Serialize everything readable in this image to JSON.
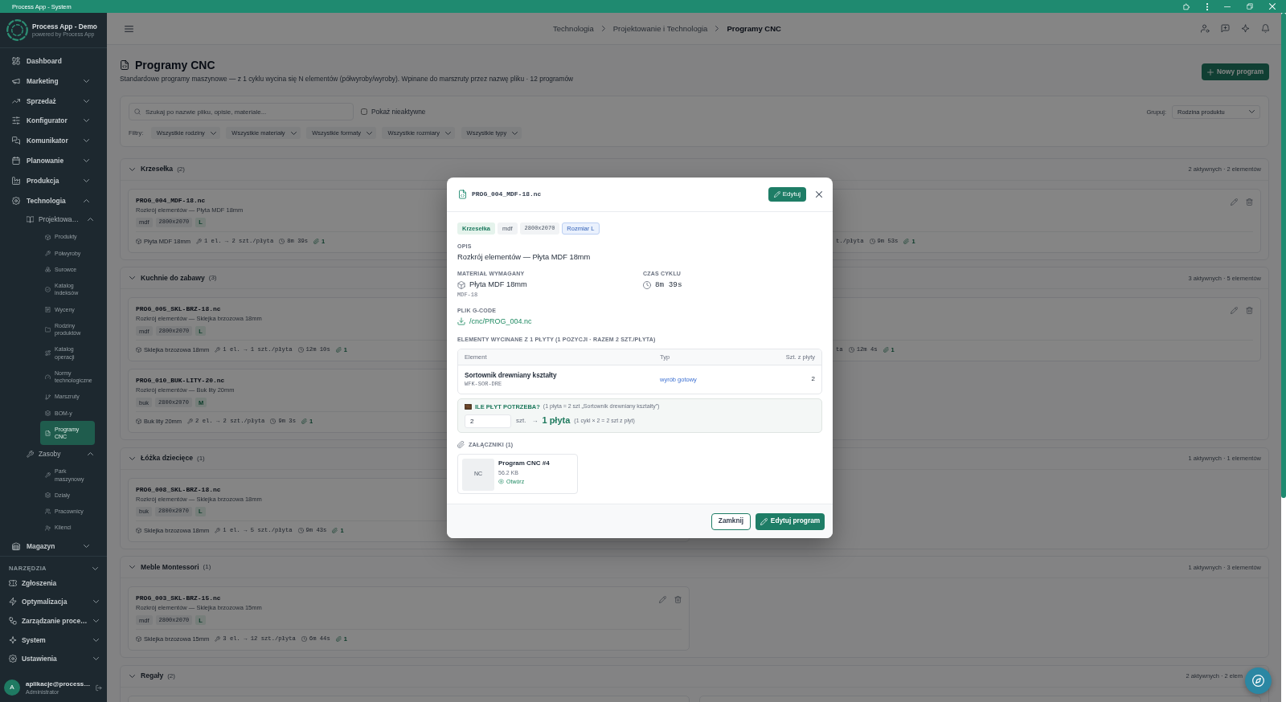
{
  "window": {
    "title": "Process App - System"
  },
  "sidebar": {
    "brand": {
      "name": "Process App - Demo",
      "tagline": "powered by Process App"
    },
    "items": [
      {
        "label": "Dashboard",
        "selected": false
      },
      {
        "label": "Marketing",
        "selected": false,
        "expanded": false
      },
      {
        "label": "Sprzedaż",
        "selected": false,
        "expanded": false
      },
      {
        "label": "Konfigurator",
        "selected": false,
        "expanded": false
      },
      {
        "label": "Komunikator",
        "selected": false,
        "expanded": false
      },
      {
        "label": "Planowanie",
        "selected": false,
        "expanded": false
      },
      {
        "label": "Produkcja",
        "selected": false,
        "expanded": false
      },
      {
        "label": "Technologia",
        "selected": false,
        "expanded": true,
        "children": [
          {
            "label": "Projektowa…",
            "selected": false,
            "expanded": true,
            "children": [
              {
                "label": "Produkty",
                "selected": false
              },
              {
                "label": "Półwyroby",
                "selected": false
              },
              {
                "label": "Surowce",
                "selected": false
              },
              {
                "label": "Katalog indeksów",
                "selected": false
              },
              {
                "label": "Wyceny",
                "selected": false
              },
              {
                "label": "Rodziny produktów",
                "selected": false
              },
              {
                "label": "Katalog operacji",
                "selected": false
              },
              {
                "label": "Normy technologiczne",
                "selected": false
              },
              {
                "label": "Marszruty",
                "selected": false
              },
              {
                "label": "BOM-y",
                "selected": false
              },
              {
                "label": "Programy CNC",
                "selected": true
              }
            ]
          },
          {
            "label": "Zasoby",
            "selected": false,
            "expanded": true,
            "children": [
              {
                "label": "Park maszynowy",
                "selected": false
              },
              {
                "label": "Działy",
                "selected": false
              },
              {
                "label": "Pracownicy",
                "selected": false
              },
              {
                "label": "Klienci",
                "selected": false
              }
            ]
          }
        ]
      },
      {
        "label": "Magazyn",
        "selected": false,
        "expanded": false
      }
    ],
    "tools": {
      "title": "NARZĘDZIA",
      "items": [
        {
          "label": "Zgłoszenia",
          "selected": false
        },
        {
          "label": "Optymalizacja",
          "selected": false,
          "expanded": false
        },
        {
          "label": "Zarządzanie proce…",
          "selected": false,
          "expanded": false
        },
        {
          "label": "System",
          "selected": false,
          "expanded": false
        },
        {
          "label": "Ustawienia",
          "selected": false,
          "expanded": false
        }
      ]
    },
    "user": {
      "initial": "A",
      "name": "aplikacje@process…",
      "role": "Administrator"
    }
  },
  "header": {
    "breadcrumb": [
      {
        "label": "Technologia",
        "selected": false
      },
      {
        "label": "Projektowanie i Technologia",
        "selected": false
      },
      {
        "label": "Programy CNC",
        "selected": true
      }
    ]
  },
  "page": {
    "title": "Programy CNC",
    "subtitle": "Standardowe programy maszynowe — z 1 cyklu wycina się N elementów (półwyroby/wyroby). Wpinane do marszruty przez nazwę pliku · 12 programów",
    "new_button": "Nowy program"
  },
  "filters": {
    "search": {
      "placeholder": "Szukaj po nazwie pliku, opisie, materiale..."
    },
    "show_inactive": {
      "label": "Pokaż nieaktywne",
      "checked": false
    },
    "group_by": {
      "label": "Grupuj:",
      "value": "Rodzina produktu"
    },
    "label": "Filtry:",
    "selects": [
      "Wszystkie rodziny",
      "Wszystkie materiały",
      "Wszystkie formaty",
      "Wszystkie rozmiary",
      "Wszystkie typy"
    ]
  },
  "groups": [
    {
      "name": "Krzesełka",
      "count": "(2)",
      "summary": "2 aktywnych · 2 elementów",
      "expanded": true,
      "programs": [
        {
          "kind": "clipped_right",
          "file": "PROG_004_MDF-18.nc",
          "description": "Rozkrój elementów — Płyta MDF 18mm",
          "tags": [
            {
              "kind": "material",
              "text": "mdf"
            },
            {
              "kind": "format",
              "text": "2800x2070"
            },
            {
              "kind": "size",
              "text": "L"
            }
          ],
          "material": "Płyta MDF 18mm",
          "output": "1 el. → 2 szt./płyta",
          "cycle_time": "8m 39s",
          "attachments": "1"
        },
        {
          "kind": "clipped_left",
          "output_tail": "t./płyta",
          "cycle_time": "9m 53s",
          "attachments": "1"
        }
      ]
    },
    {
      "name": "Kuchnie do zabawy",
      "count": "(3)",
      "summary": "3 aktywnych · 5 elementów",
      "expanded": true,
      "programs": [
        {
          "kind": "clipped_right",
          "file": "PROG_005_SKL-BRZ-18.nc",
          "description": "Rozkrój elementów — Sklejka brzozowa 18mm",
          "tags": [
            {
              "kind": "material",
              "text": "mdf"
            },
            {
              "kind": "format",
              "text": "2800x2070"
            },
            {
              "kind": "size",
              "text": "L"
            }
          ],
          "material": "Sklejka brzozowa 18mm",
          "output": "1 el. → 1 szt./płyta",
          "cycle_time": "12m 10s",
          "attachments": "1"
        },
        {
          "kind": "clipped_left",
          "output_tail": "ta",
          "cycle_time": "12m 4s",
          "attachments": "1"
        },
        {
          "kind": "clipped_right",
          "file": "PROG_010_BUK-LITY-20.nc",
          "description": "Rozkrój elementów — Buk lity 20mm",
          "tags": [
            {
              "kind": "material",
              "text": "buk"
            },
            {
              "kind": "format",
              "text": "2800x2070"
            },
            {
              "kind": "size",
              "text": "M"
            }
          ],
          "material": "Buk lity 20mm",
          "output": "2 el. → 2 szt./płyta",
          "cycle_time": "9m 3s",
          "attachments": "1"
        }
      ]
    },
    {
      "name": "Łóżka dziecięce",
      "count": "(1)",
      "summary": "1 aktywnych · 1 elementów",
      "expanded": true,
      "programs": [
        {
          "kind": "clipped_right",
          "file": "PROG_008_SKL-BRZ-18.nc",
          "description": "Rozkrój elementów — Sklejka brzozowa 18mm",
          "tags": [
            {
              "kind": "material",
              "text": "buk"
            },
            {
              "kind": "format",
              "text": "2800x2070"
            },
            {
              "kind": "size",
              "text": "L"
            }
          ],
          "material": "Sklejka brzozowa 18mm",
          "output": "1 el. → 5 szt./płyta",
          "cycle_time": "9m 43s",
          "attachments": "1"
        }
      ]
    },
    {
      "name": "Meble Montessori",
      "count": "(1)",
      "summary": "1 aktywnych · 3 elementów",
      "expanded": true,
      "programs": [
        {
          "kind": "full",
          "file": "PROG_003_SKL-BRZ-15.nc",
          "description": "Rozkrój elementów — Sklejka brzozowa 15mm",
          "tags": [
            {
              "kind": "material",
              "text": "mdf"
            },
            {
              "kind": "format",
              "text": "2800x2070"
            },
            {
              "kind": "size",
              "text": "L"
            }
          ],
          "material": "Sklejka brzozowa 15mm",
          "output": "3 el. → 12 szt./płyta",
          "cycle_time": "6m 44s",
          "attachments": "1"
        }
      ]
    },
    {
      "name": "Regały",
      "count": "(2)",
      "summary": "2 aktywnych · 2 elem",
      "expanded": true,
      "programs": [
        {
          "kind": "cut_off"
        },
        {
          "kind": "cut_off"
        }
      ]
    }
  ],
  "modal": {
    "title": "PROG_004_MDF-18.nc",
    "edit_button": "Edytuj",
    "tags": [
      {
        "kind": "family",
        "text": "Krzesełka"
      },
      {
        "kind": "material",
        "text": "mdf"
      },
      {
        "kind": "format",
        "text": "2800x2070"
      },
      {
        "kind": "size",
        "text": "Rozmiar L"
      }
    ],
    "description": {
      "label": "OPIS",
      "value": "Rozkrój elementów — Płyta MDF 18mm"
    },
    "material": {
      "label": "MATERIAŁ WYMAGANY",
      "value": "Płyta MDF 18mm",
      "code": "MDF-18"
    },
    "cycle": {
      "label": "CZAS CYKLU",
      "value": "8m 39s"
    },
    "gcode": {
      "label": "PLIK G-CODE",
      "path": "/cnc/PROG_004.nc"
    },
    "elements": {
      "title": "ELEMENTY WYCINANE Z 1 PŁYTY (1 POZYCJI · RAZEM 2 SZT./PŁYTA)",
      "columns": [
        "Element",
        "Typ",
        "Szt. z płyty"
      ],
      "rows": [
        {
          "name": "Sortownik drewniany kształty",
          "code": "WFK-SOR-DRE",
          "type": "wyrób gotowy",
          "qty": "2"
        }
      ]
    },
    "calculator": {
      "title": "ILE PŁYT POTRZEBA?",
      "note": "(1 płyta = 2 szt „Sortownik drewniany kształty”)",
      "quantity": "2",
      "unit": "szt.",
      "arrow": "→",
      "result": "1 płyta",
      "formula": "(1 cykl × 2 = 2 szt z płyt)"
    },
    "attachments": {
      "title": "ZAŁĄCZNIKI (1)",
      "files": [
        {
          "thumb": "NC",
          "name": "Program CNC #4",
          "size": "56.2 KB",
          "open": "Otwórz"
        }
      ]
    },
    "footer": {
      "close": "Zamknij",
      "edit": "Edytuj program"
    }
  }
}
